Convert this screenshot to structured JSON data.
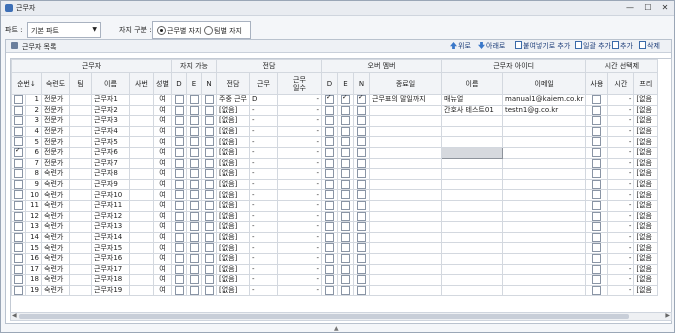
{
  "window": {
    "title": "근무자",
    "min": "—",
    "max": "☐",
    "close": "✕"
  },
  "filters": {
    "part_label": "파트 :",
    "part_value": "기본 파트",
    "position_label": "자지 구분 :",
    "radio1": "근무별 자지",
    "radio2": "팀별 자지"
  },
  "panel": {
    "title": "근무자 목록",
    "buttons": {
      "up": "위로",
      "down": "아래로",
      "batch_add": "붙여넣기로 추가",
      "bulk": "일괄 추가",
      "add": "추가",
      "delete": "삭제"
    }
  },
  "grid": {
    "groups": {
      "worker": "근무자",
      "availability": "자지 가능",
      "assignment": "전담",
      "over": "오버 멤버",
      "account": "근무자 아이디",
      "time": "시간 선택제"
    },
    "headers": {
      "order": "순번",
      "sort_mark": "↓",
      "skill": "숙련도",
      "team": "팀",
      "name": "이름",
      "empno": "사번",
      "gender": "성별",
      "d": "D",
      "e": "E",
      "n": "N",
      "assign": "전담",
      "duty": "근무",
      "days": "근무\n일수",
      "od": "D",
      "oe": "E",
      "on": "N",
      "enddate": "종료일",
      "acc_name": "이름",
      "email": "이메일",
      "use": "사용",
      "hours": "시간",
      "pre": "프리"
    },
    "rows": [
      {
        "no": "1",
        "checked": false,
        "skill": "전문가",
        "name": "근무자1",
        "gender": "여",
        "assign": "주중 근무",
        "duty": "D",
        "days": "-",
        "od": true,
        "oe": true,
        "on": true,
        "enddate": "근무표의 말일까지",
        "acc_name": "매뉴얼",
        "email": "manual1@kaiem.co.kr",
        "hours": "-",
        "pre": "[없음"
      },
      {
        "no": "2",
        "checked": false,
        "skill": "전문가",
        "name": "근무자2",
        "gender": "여",
        "assign": "[없음]",
        "duty": "-",
        "days": "-",
        "od": false,
        "oe": false,
        "on": false,
        "enddate": "",
        "acc_name": "간호사 테스트01",
        "email": "testn1@g.co.kr",
        "hours": "-",
        "pre": "[없음"
      },
      {
        "no": "3",
        "checked": false,
        "skill": "전문가",
        "name": "근무자3",
        "gender": "여",
        "assign": "[없음]",
        "duty": "-",
        "days": "-",
        "od": false,
        "oe": false,
        "on": false,
        "enddate": "",
        "acc_name": "",
        "email": "",
        "hours": "-",
        "pre": "[없음"
      },
      {
        "no": "4",
        "checked": false,
        "skill": "전문가",
        "name": "근무자4",
        "gender": "여",
        "assign": "[없음]",
        "duty": "-",
        "days": "-",
        "od": false,
        "oe": false,
        "on": false,
        "enddate": "",
        "acc_name": "",
        "email": "",
        "hours": "-",
        "pre": "[없음"
      },
      {
        "no": "5",
        "checked": false,
        "skill": "전문가",
        "name": "근무자5",
        "gender": "여",
        "assign": "[없음]",
        "duty": "-",
        "days": "-",
        "od": false,
        "oe": false,
        "on": false,
        "enddate": "",
        "acc_name": "",
        "email": "",
        "hours": "-",
        "pre": "[없음"
      },
      {
        "no": "6",
        "checked": true,
        "skill": "전문가",
        "name": "근무자6",
        "gender": "여",
        "assign": "[없음]",
        "duty": "-",
        "days": "-",
        "od": false,
        "oe": false,
        "on": false,
        "enddate": "",
        "acc_name": "",
        "email": "",
        "hours": "-",
        "pre": "[없음"
      },
      {
        "no": "7",
        "checked": false,
        "skill": "전문가",
        "name": "근무자7",
        "gender": "여",
        "assign": "[없음]",
        "duty": "-",
        "days": "-",
        "od": false,
        "oe": false,
        "on": false,
        "enddate": "",
        "acc_name": "",
        "email": "",
        "hours": "-",
        "pre": "[없음"
      },
      {
        "no": "8",
        "checked": false,
        "skill": "숙련가",
        "name": "근무자8",
        "gender": "여",
        "assign": "[없음]",
        "duty": "-",
        "days": "-",
        "od": false,
        "oe": false,
        "on": false,
        "enddate": "",
        "acc_name": "",
        "email": "",
        "hours": "-",
        "pre": "[없음"
      },
      {
        "no": "9",
        "checked": false,
        "skill": "숙련가",
        "name": "근무자9",
        "gender": "여",
        "assign": "[없음]",
        "duty": "-",
        "days": "-",
        "od": false,
        "oe": false,
        "on": false,
        "enddate": "",
        "acc_name": "",
        "email": "",
        "hours": "-",
        "pre": "[없음"
      },
      {
        "no": "10",
        "checked": false,
        "skill": "숙련가",
        "name": "근무자10",
        "gender": "여",
        "assign": "[없음]",
        "duty": "-",
        "days": "-",
        "od": false,
        "oe": false,
        "on": false,
        "enddate": "",
        "acc_name": "",
        "email": "",
        "hours": "-",
        "pre": "[없음"
      },
      {
        "no": "11",
        "checked": false,
        "skill": "숙련가",
        "name": "근무자11",
        "gender": "여",
        "assign": "[없음]",
        "duty": "-",
        "days": "-",
        "od": false,
        "oe": false,
        "on": false,
        "enddate": "",
        "acc_name": "",
        "email": "",
        "hours": "-",
        "pre": "[없음"
      },
      {
        "no": "12",
        "checked": false,
        "skill": "숙련가",
        "name": "근무자12",
        "gender": "여",
        "assign": "[없음]",
        "duty": "-",
        "days": "-",
        "od": false,
        "oe": false,
        "on": false,
        "enddate": "",
        "acc_name": "",
        "email": "",
        "hours": "-",
        "pre": "[없음"
      },
      {
        "no": "13",
        "checked": false,
        "skill": "숙련가",
        "name": "근무자13",
        "gender": "여",
        "assign": "[없음]",
        "duty": "-",
        "days": "-",
        "od": false,
        "oe": false,
        "on": false,
        "enddate": "",
        "acc_name": "",
        "email": "",
        "hours": "-",
        "pre": "[없음"
      },
      {
        "no": "14",
        "checked": false,
        "skill": "숙련가",
        "name": "근무자14",
        "gender": "여",
        "assign": "[없음]",
        "duty": "-",
        "days": "-",
        "od": false,
        "oe": false,
        "on": false,
        "enddate": "",
        "acc_name": "",
        "email": "",
        "hours": "-",
        "pre": "[없음"
      },
      {
        "no": "15",
        "checked": false,
        "skill": "숙련가",
        "name": "근무자15",
        "gender": "여",
        "assign": "[없음]",
        "duty": "-",
        "days": "-",
        "od": false,
        "oe": false,
        "on": false,
        "enddate": "",
        "acc_name": "",
        "email": "",
        "hours": "-",
        "pre": "[없음"
      },
      {
        "no": "16",
        "checked": false,
        "skill": "숙련가",
        "name": "근무자16",
        "gender": "여",
        "assign": "[없음]",
        "duty": "-",
        "days": "-",
        "od": false,
        "oe": false,
        "on": false,
        "enddate": "",
        "acc_name": "",
        "email": "",
        "hours": "-",
        "pre": "[없음"
      },
      {
        "no": "17",
        "checked": false,
        "skill": "숙련가",
        "name": "근무자17",
        "gender": "여",
        "assign": "[없음]",
        "duty": "-",
        "days": "-",
        "od": false,
        "oe": false,
        "on": false,
        "enddate": "",
        "acc_name": "",
        "email": "",
        "hours": "-",
        "pre": "[없음"
      },
      {
        "no": "18",
        "checked": false,
        "skill": "숙련가",
        "name": "근무자18",
        "gender": "여",
        "assign": "[없음]",
        "duty": "-",
        "days": "-",
        "od": false,
        "oe": false,
        "on": false,
        "enddate": "",
        "acc_name": "",
        "email": "",
        "hours": "-",
        "pre": "[없음"
      },
      {
        "no": "19",
        "checked": false,
        "skill": "숙련가",
        "name": "근무자19",
        "gender": "여",
        "assign": "[없음]",
        "duty": "-",
        "days": "-",
        "od": false,
        "oe": false,
        "on": false,
        "enddate": "",
        "acc_name": "",
        "email": "",
        "hours": "-",
        "pre": "[없음"
      }
    ]
  }
}
